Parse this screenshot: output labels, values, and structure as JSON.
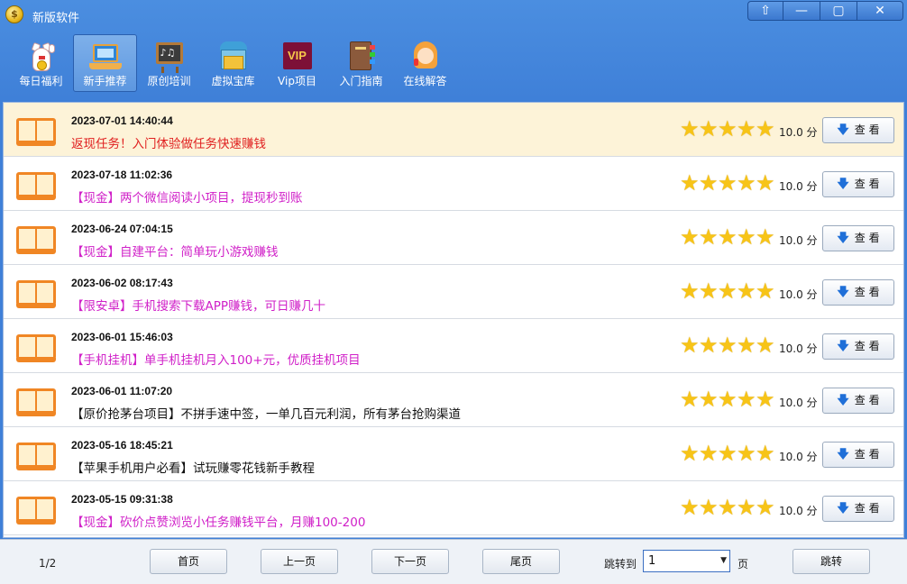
{
  "window": {
    "title": "新版软件",
    "controls": [
      "⇧",
      "—",
      "▢",
      "✕"
    ]
  },
  "toolbar": {
    "items": [
      {
        "label": "每日福利",
        "icon": "lucky-cat-icon",
        "active": false
      },
      {
        "label": "新手推荐",
        "icon": "laptop-icon",
        "active": true
      },
      {
        "label": "原创培训",
        "icon": "blackboard-icon",
        "active": false
      },
      {
        "label": "虚拟宝库",
        "icon": "warehouse-icon",
        "active": false
      },
      {
        "label": "Vip项目",
        "icon": "vip-icon",
        "active": false
      },
      {
        "label": "入门指南",
        "icon": "books-icon",
        "active": false
      },
      {
        "label": "在线解答",
        "icon": "customer-service-icon",
        "active": false
      }
    ],
    "vip_badge_text": "VIP"
  },
  "list": {
    "rows": [
      {
        "date": "2023-07-01 14:40:44",
        "title": "返现任务！入门体验做任务快速赚钱",
        "color": "#e02020",
        "score": "10.0 分",
        "button": "查 看"
      },
      {
        "date": "2023-07-18 11:02:36",
        "title": "【现金】两个微信阅读小项目，提现秒到账",
        "color": "#d020c8",
        "score": "10.0 分",
        "button": "查 看"
      },
      {
        "date": "2023-06-24 07:04:15",
        "title": "【现金】自建平台：简单玩小游戏赚钱",
        "color": "#d020c8",
        "score": "10.0 分",
        "button": "查 看"
      },
      {
        "date": "2023-06-02 08:17:43",
        "title": "【限安卓】手机搜索下载APP赚钱，可日赚几十",
        "color": "#d020c8",
        "score": "10.0 分",
        "button": "查 看"
      },
      {
        "date": "2023-06-01 15:46:03",
        "title": "【手机挂机】单手机挂机月入100+元，优质挂机项目",
        "color": "#d020c8",
        "score": "10.0 分",
        "button": "查 看"
      },
      {
        "date": "2023-06-01 11:07:20",
        "title": "【原价抢茅台项目】不拼手速中签，一单几百元利润，所有茅台抢购渠道",
        "color": "#111111",
        "score": "10.0 分",
        "button": "查 看"
      },
      {
        "date": "2023-05-16 18:45:21",
        "title": "【苹果手机用户必看】试玩赚零花钱新手教程",
        "color": "#111111",
        "score": "10.0 分",
        "button": "查 看"
      },
      {
        "date": "2023-05-15 09:31:38",
        "title": "【现金】砍价点赞浏览小任务赚钱平台，月赚100-200",
        "color": "#d020c8",
        "score": "10.0 分",
        "button": "查 看"
      }
    ],
    "stars_per_row": 5,
    "star_glyph": "★",
    "arrow_glyph": "🡇"
  },
  "footer": {
    "page_info": "1/2",
    "first": "首页",
    "prev": "上一页",
    "next": "下一页",
    "last": "尾页",
    "jump_label": "跳转到",
    "jump_value": "1",
    "page_unit": "页",
    "jump_button": "跳转"
  },
  "colors": {
    "accent": "#3f80d8",
    "highlight_row": "#fdf3d8",
    "star": "#f7c417"
  }
}
